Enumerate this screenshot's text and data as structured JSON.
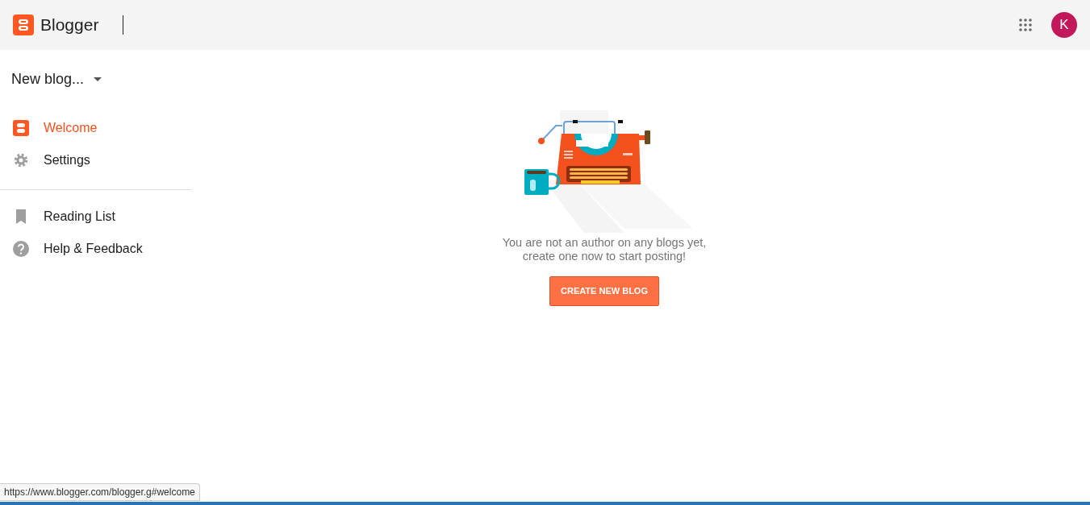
{
  "header": {
    "title": "Blogger",
    "avatar_letter": "K"
  },
  "blog_picker": {
    "label": "New blog..."
  },
  "sidebar": {
    "groups": [
      {
        "items": [
          {
            "label": "Welcome",
            "kind": "blogger",
            "selected": true
          },
          {
            "label": "Settings",
            "kind": "gear",
            "selected": false
          }
        ]
      },
      {
        "items": [
          {
            "label": "Reading List",
            "kind": "bookmark",
            "selected": false
          },
          {
            "label": "Help & Feedback",
            "kind": "help",
            "selected": false
          }
        ]
      }
    ]
  },
  "empty_state": {
    "message_lines": [
      "You are not an author on any blogs yet,",
      "create one now to start posting!"
    ],
    "button": "CREATE NEW BLOG"
  },
  "status_bar": {
    "url": "https://www.blogger.com/blogger.g#welcome"
  }
}
